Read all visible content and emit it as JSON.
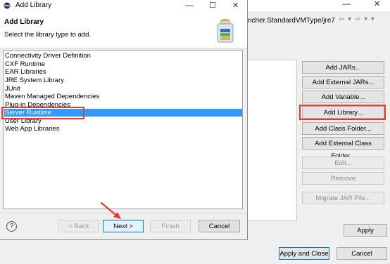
{
  "dialog": {
    "title": "Add Library",
    "header_title": "Add Library",
    "header_subtitle": "Select the library type to add.",
    "library_types": [
      {
        "label": "Connectivity Driver Definition",
        "selected": false
      },
      {
        "label": "CXF Runtime",
        "selected": false
      },
      {
        "label": "EAR Libraries",
        "selected": false
      },
      {
        "label": "JRE System Library",
        "selected": false
      },
      {
        "label": "JUnit",
        "selected": false
      },
      {
        "label": "Maven Managed Dependencies",
        "selected": false
      },
      {
        "label": "Plug-in Dependencies",
        "selected": false
      },
      {
        "label": "Server Runtime",
        "selected": true
      },
      {
        "label": "User Library",
        "selected": false
      },
      {
        "label": "Web App Libraries",
        "selected": false
      }
    ],
    "buttons": {
      "help": "?",
      "back": "< Back",
      "next": "Next >",
      "finish": "Finish",
      "cancel": "Cancel"
    }
  },
  "background_window": {
    "path_fragment": "ncher.StandardVMType/jre7",
    "nav_arrows": "⇦ ▾ ⇨ ▾ ▾",
    "buttons": [
      {
        "label": "Add JARs...",
        "enabled": true
      },
      {
        "label": "Add External JARs...",
        "enabled": true
      },
      {
        "label": "Add Variable...",
        "enabled": true
      },
      {
        "label": "Add Library...",
        "enabled": true
      },
      {
        "label": "Add Class Folder...",
        "enabled": true
      },
      {
        "label": "Add External Class Folder...",
        "enabled": true
      },
      {
        "label": "Edit...",
        "enabled": false
      },
      {
        "label": "Remove",
        "enabled": false
      },
      {
        "label": "Migrate JAR File...",
        "enabled": false
      }
    ],
    "apply": "Apply",
    "apply_and_close": "Apply and Close",
    "cancel": "Cancel"
  },
  "colors": {
    "selection": "#3399ff",
    "highlight": "#e8392f",
    "default_button_border": "#0078d7"
  }
}
